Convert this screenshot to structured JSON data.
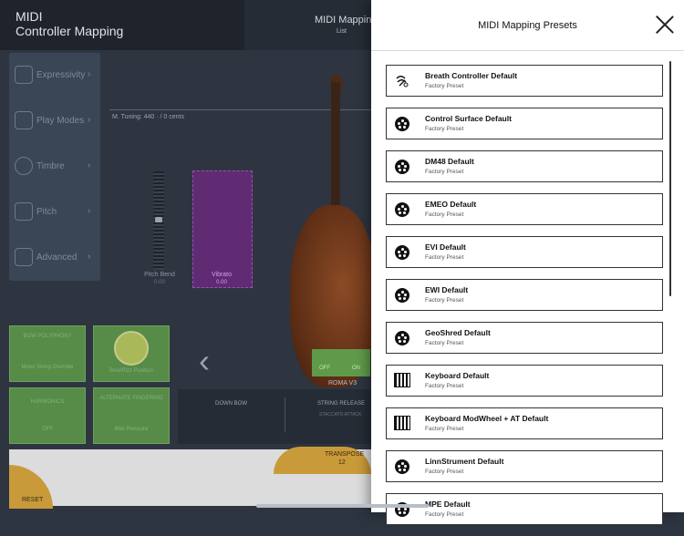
{
  "app": {
    "title_line1": "MIDI",
    "title_line2": "Controller Mapping",
    "center_title": "MIDI Mapping",
    "center_subtitle": "List"
  },
  "sidebar": {
    "items": [
      {
        "label": "Expressivity",
        "icon": "expressivity-icon"
      },
      {
        "label": "Play Modes",
        "icon": "play-modes-icon"
      },
      {
        "label": "Timbre",
        "icon": "timbre-icon"
      },
      {
        "label": "Pitch",
        "icon": "pitch-icon"
      },
      {
        "label": "Advanced",
        "icon": "advanced-icon"
      }
    ]
  },
  "main": {
    "tuning": "M. Tuning: 440 · / 0 cents",
    "pitch_bend_label": "Pitch Bend",
    "pitch_bend_value": "0.00",
    "vibrato_label": "Vibrato",
    "vibrato_value": "0.00",
    "bow_polyphony": "BOW POLYPHONY",
    "bow_polyphony_value": "Mono String Override",
    "bow_position": "Bow/Pizz Position",
    "harmonics": "HARMONICS",
    "harmonics_value": "OFF",
    "alt_fingering": "ALTERNATE FINGERING",
    "alt_fingering_value": "Midi Pressure",
    "down_bow": "DOWN BOW",
    "string_release": "STRING RELEASE",
    "staccato": "STACCATO ATTACK",
    "roma": "ROMA V3",
    "toggle_off": "OFF",
    "toggle_on": "ON",
    "transpose_label": "TRANSPOSE",
    "transpose_value": "12",
    "reset_label": "RESET"
  },
  "panel": {
    "title": "MIDI Mapping Presets",
    "presets": [
      {
        "name": "Breath Controller Default",
        "sub": "Factory Preset",
        "icon": "breath-controller-icon"
      },
      {
        "name": "Control Surface Default",
        "sub": "Factory Preset",
        "icon": "midi-din-icon"
      },
      {
        "name": "DM48 Default",
        "sub": "Factory Preset",
        "icon": "midi-din-icon"
      },
      {
        "name": "EMEO Default",
        "sub": "Factory Preset",
        "icon": "midi-din-icon"
      },
      {
        "name": "EVI Default",
        "sub": "Factory Preset",
        "icon": "midi-din-icon"
      },
      {
        "name": "EWI Default",
        "sub": "Factory Preset",
        "icon": "midi-din-icon"
      },
      {
        "name": "GeoShred Default",
        "sub": "Factory Preset",
        "icon": "midi-din-icon"
      },
      {
        "name": "Keyboard Default",
        "sub": "Factory Preset",
        "icon": "keyboard-icon"
      },
      {
        "name": "Keyboard ModWheel + AT Default",
        "sub": "Factory Preset",
        "icon": "keyboard-icon"
      },
      {
        "name": "LinnStrument Default",
        "sub": "Factory Preset",
        "icon": "midi-din-icon"
      },
      {
        "name": "MPE Default",
        "sub": "Factory Preset",
        "icon": "midi-din-icon"
      }
    ]
  }
}
